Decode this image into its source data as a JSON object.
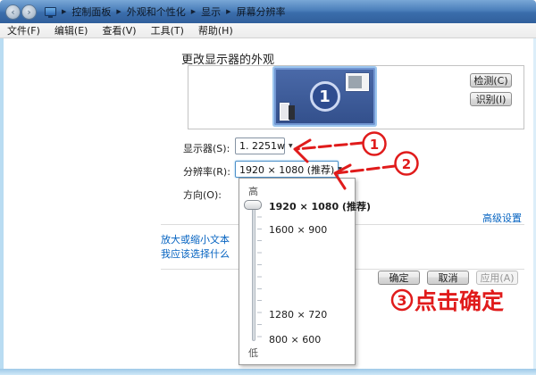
{
  "breadcrumb": {
    "separator": "▶",
    "items": [
      "控制面板",
      "外观和个性化",
      "显示",
      "屏幕分辨率"
    ]
  },
  "nav": {
    "back": "‹",
    "forward": "›"
  },
  "menu": {
    "items": [
      "文件(F)",
      "编辑(E)",
      "查看(V)",
      "工具(T)",
      "帮助(H)"
    ]
  },
  "main": {
    "heading": "更改显示器的外观",
    "monitor_number": "1",
    "buttons": {
      "detect": "检测(C)",
      "identify": "识别(I)",
      "ok": "确定",
      "cancel": "取消",
      "apply": "应用(A)"
    },
    "fields": {
      "display_label": "显示器(S):",
      "display_value": "1. 2251w",
      "resolution_label": "分辨率(R):",
      "resolution_value": "1920 × 1080 (推荐)",
      "orientation_label": "方向(O):"
    },
    "links": {
      "advanced": "高级设置",
      "text_size": "放大或缩小文本",
      "choose_help": "我应该选择什么"
    },
    "chevron": "▼"
  },
  "resolution_dropdown": {
    "high": "高",
    "low": "低",
    "selected_index": 0,
    "options": [
      "1920 × 1080 (推荐)",
      "1600 × 900",
      "1280 × 720",
      "800 × 600"
    ]
  },
  "annotations": {
    "color": "#e01b1b",
    "step1_num": "1",
    "step2_num": "2",
    "step3_num": "3",
    "step3_text": "点击确定"
  }
}
